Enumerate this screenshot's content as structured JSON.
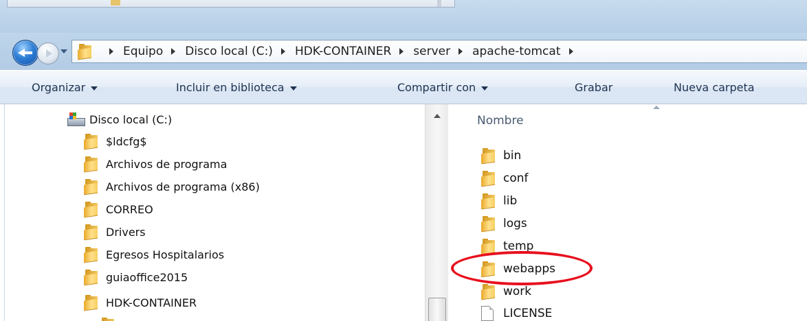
{
  "navigation": {
    "breadcrumbs": [
      "Equipo",
      "Disco local (C:)",
      "HDK-CONTAINER",
      "server",
      "apache-tomcat"
    ]
  },
  "toolbar": {
    "organize": "Organizar",
    "include_library": "Incluir en biblioteca",
    "share_with": "Compartir con",
    "burn": "Grabar",
    "new_folder": "Nueva carpeta"
  },
  "nav_pane": {
    "drive": "Disco local (C:)",
    "folders": [
      "$ldcfg$",
      "Archivos de programa",
      "Archivos de programa (x86)",
      "CORREO",
      "Drivers",
      "Egresos Hospitalarios",
      "guiaoffice2015",
      "HDK-CONTAINER"
    ]
  },
  "content": {
    "column_header": "Nombre",
    "items": [
      {
        "name": "bin",
        "type": "folder"
      },
      {
        "name": "conf",
        "type": "folder"
      },
      {
        "name": "lib",
        "type": "folder"
      },
      {
        "name": "logs",
        "type": "folder"
      },
      {
        "name": "temp",
        "type": "folder"
      },
      {
        "name": "webapps",
        "type": "folder",
        "highlighted": true
      },
      {
        "name": "work",
        "type": "folder"
      },
      {
        "name": "LICENSE",
        "type": "file"
      }
    ]
  },
  "colors": {
    "highlight_circle": "#e8101e",
    "folder": "#f2c860",
    "nav_background": "#b9d1e8"
  }
}
